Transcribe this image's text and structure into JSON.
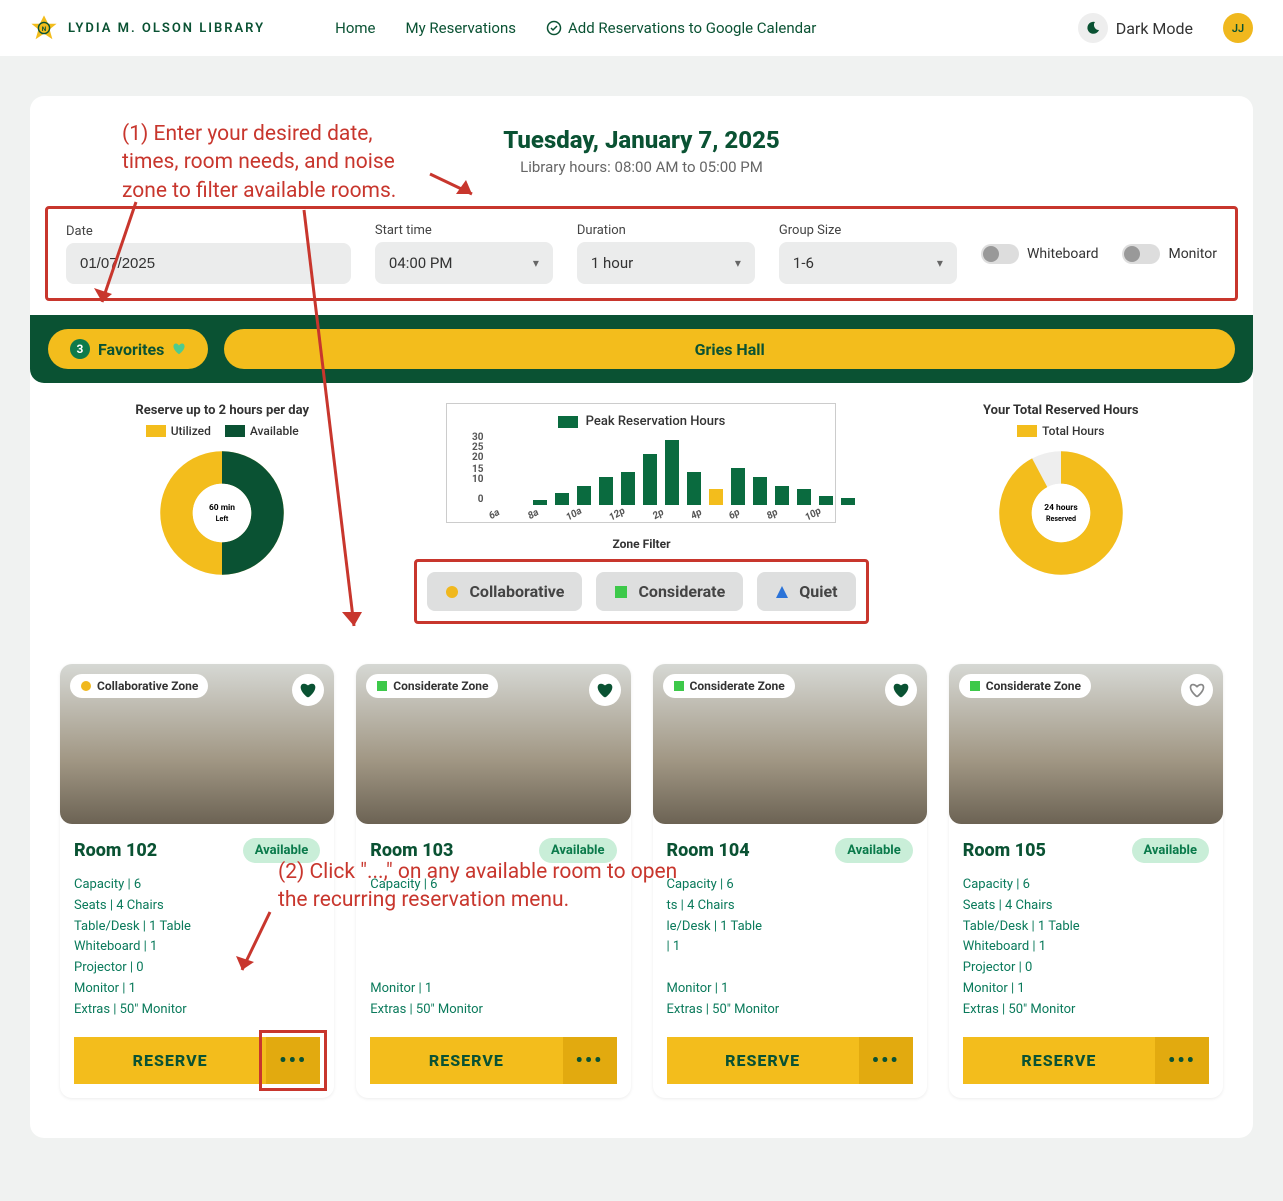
{
  "brand": "LYDIA M. OLSON LIBRARY",
  "nav": {
    "home": "Home",
    "my_reservations": "My Reservations",
    "add_to_cal": "Add Reservations to Google Calendar",
    "dark_mode": "Dark Mode"
  },
  "avatar_initials": "JJ",
  "header": {
    "title": "Tuesday, January 7, 2025",
    "hours": "Library hours: 08:00 AM to 05:00 PM"
  },
  "annotations": {
    "a1": "(1) Enter your desired date, times, room needs, and noise zone to filter available rooms.",
    "a2": "(2) Click \"...,\" on any available room to open the recurring reservation menu."
  },
  "filters": {
    "date_label": "Date",
    "date_value": "01/07/2025",
    "start_label": "Start time",
    "start_value": "04:00 PM",
    "duration_label": "Duration",
    "duration_value": "1 hour",
    "group_label": "Group Size",
    "group_value": "1-6",
    "whiteboard_label": "Whiteboard",
    "monitor_label": "Monitor"
  },
  "favorites": {
    "count": "3",
    "label": "Favorites"
  },
  "building": "Gries Hall",
  "stats": {
    "left_title": "Reserve up to 2 hours per day",
    "left_legend_util": "Utilized",
    "left_legend_avail": "Available",
    "left_center": "60 min",
    "left_center_sub": "Left",
    "right_title": "Your Total Reserved Hours",
    "right_legend": "Total Hours",
    "right_center": "24 hours",
    "right_center_sub": "Reserved"
  },
  "zone_filter": {
    "title": "Zone Filter",
    "c1": "Collaborative",
    "c2": "Considerate",
    "c3": "Quiet"
  },
  "rooms": [
    {
      "name": "Room 102",
      "zone": "Collaborative Zone",
      "zone_shape": "circle",
      "status": "Available",
      "fav": true,
      "specs": [
        "Capacity | 6",
        "Seats | 4 Chairs",
        "Table/Desk | 1 Table",
        "Whiteboard | 1",
        "Projector | 0",
        "Monitor | 1",
        "Extras | 50\" Monitor"
      ]
    },
    {
      "name": "Room 103",
      "zone": "Considerate Zone",
      "zone_shape": "square",
      "status": "Available",
      "fav": true,
      "specs": [
        "Capacity | 6",
        "",
        "",
        "",
        "",
        "Monitor | 1",
        "Extras | 50\" Monitor"
      ]
    },
    {
      "name": "Room 104",
      "zone": "Considerate Zone",
      "zone_shape": "square",
      "status": "Available",
      "fav": true,
      "specs": [
        "Capacity | 6",
        "ts | 4 Chairs",
        "le/Desk | 1 Table",
        "| 1",
        "",
        "Monitor | 1",
        "Extras | 50\" Monitor"
      ]
    },
    {
      "name": "Room 105",
      "zone": "Considerate Zone",
      "zone_shape": "square",
      "status": "Available",
      "fav": false,
      "specs": [
        "Capacity | 6",
        "Seats | 4 Chairs",
        "Table/Desk | 1 Table",
        "Whiteboard | 1",
        "Projector | 0",
        "Monitor | 1",
        "Extras | 50\" Monitor"
      ]
    }
  ],
  "reserve_label": "RESERVE",
  "chart_data": {
    "type": "bar",
    "title": "Peak Reservation Hours",
    "ylabel": "",
    "ylim": [
      0,
      30
    ],
    "yticks": [
      0,
      10,
      15,
      20,
      25,
      30
    ],
    "categories": [
      "6a",
      "",
      "8a",
      "",
      "10a",
      "",
      "12p",
      "",
      "2p",
      "",
      "4p",
      "",
      "6p",
      "",
      "8p",
      "",
      "10p"
    ],
    "values": [
      0,
      0,
      2,
      5,
      8,
      12,
      14,
      22,
      28,
      14,
      7,
      16,
      12,
      8,
      7,
      4,
      3
    ],
    "highlight_index": 10,
    "series_colors": {
      "default": "#0a6b3f",
      "highlight": "#f3bd1c"
    }
  },
  "donut_left": {
    "utilized_pct": 50,
    "available_pct": 50
  },
  "donut_right": {
    "total_pct": 92
  }
}
